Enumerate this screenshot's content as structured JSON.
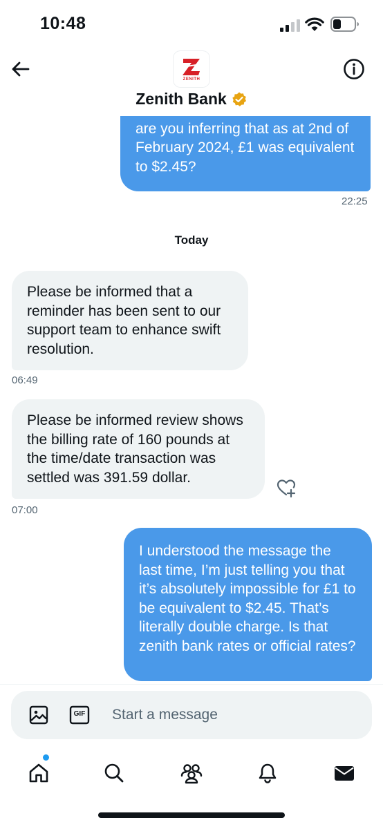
{
  "status_bar": {
    "time": "10:48"
  },
  "header": {
    "title": "Zenith Bank",
    "avatar_word": "ZENITH"
  },
  "messages": [
    {
      "id": "m1",
      "direction": "outgoing",
      "text": "are you inferring that as at 2nd of February 2024, £1 was equivalent to $2.45?",
      "time": "22:25"
    },
    {
      "id": "m2",
      "direction": "incoming",
      "text": "Please be informed that a reminder has been sent to our support team to enhance swift resolution.",
      "time": "06:49"
    },
    {
      "id": "m3",
      "direction": "incoming",
      "text": "Please be informed review shows the billing rate of 160 pounds at the time/date transaction was settled was 391.59 dollar.",
      "time": "07:00"
    },
    {
      "id": "m4",
      "direction": "outgoing",
      "text": "I understood the message the last time, I’m just telling you that it’s absolutely impossible for £1 to be equivalent to $2.45. That’s literally double charge. Is that zenith bank rates or official rates?"
    }
  ],
  "day_divider": "Today",
  "composer": {
    "placeholder": "Start a message",
    "gif_label": "GIF"
  },
  "colors": {
    "accent": "#1d9bf0",
    "outgoing_bubble": "#4a99e9",
    "incoming_bubble": "#eff3f4",
    "verified": "#e8a412",
    "brand": "#d72027"
  },
  "icons": {
    "back": "arrow-left-icon",
    "info": "info-icon",
    "verified": "verified-badge-icon",
    "image": "image-icon",
    "gif": "gif-icon",
    "voice": "voice-wave-icon",
    "react": "heart-plus-icon",
    "nav": [
      "home-icon",
      "search-icon",
      "communities-icon",
      "notifications-icon",
      "messages-icon"
    ]
  }
}
